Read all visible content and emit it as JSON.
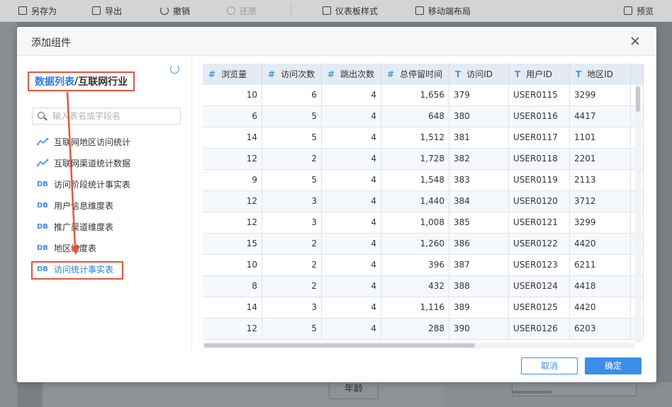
{
  "toolbar": {
    "save_as": "另存为",
    "export": "导出",
    "undo": "撤销",
    "redo": "还原",
    "dashboard_style": "仪表板样式",
    "mobile_layout": "移动端布局",
    "preview": "预览"
  },
  "background": {
    "tag_label": "年龄"
  },
  "dialog": {
    "title": "添加组件",
    "cancel_label": "取消",
    "ok_label": "确定"
  },
  "tree": {
    "breadcrumb_link": "数据列表",
    "breadcrumb_sep": "/",
    "breadcrumb_current": "互联网行业",
    "search_placeholder": "输入表名或字段名",
    "items": [
      {
        "icon": "chart-line-icon",
        "label": "互联网地区访问统计"
      },
      {
        "icon": "chart-line-icon",
        "label": "互联网渠道统计数据"
      },
      {
        "icon": "db-icon",
        "label": "访问阶段统计事实表"
      },
      {
        "icon": "db-icon",
        "label": "用户信息维度表"
      },
      {
        "icon": "db-icon",
        "label": "推广渠道维度表"
      },
      {
        "icon": "db-icon",
        "label": "地区维度表"
      },
      {
        "icon": "db-icon",
        "label": "访问统计事实表"
      }
    ],
    "db_glyph": "DB"
  },
  "grid": {
    "columns": [
      {
        "icon": "#",
        "label": "浏览量"
      },
      {
        "icon": "#",
        "label": "访问次数"
      },
      {
        "icon": "#",
        "label": "跳出次数"
      },
      {
        "icon": "#",
        "label": "总停留时间"
      },
      {
        "icon": "T",
        "label": "访问ID"
      },
      {
        "icon": "T",
        "label": "用户ID"
      },
      {
        "icon": "T",
        "label": "地区ID"
      }
    ],
    "rows": [
      [
        "10",
        "6",
        "4",
        "1,656",
        "379",
        "USER0115",
        "3299"
      ],
      [
        "6",
        "5",
        "4",
        "648",
        "380",
        "USER0116",
        "4417"
      ],
      [
        "14",
        "5",
        "4",
        "1,512",
        "381",
        "USER0117",
        "1101"
      ],
      [
        "12",
        "2",
        "4",
        "1,728",
        "382",
        "USER0118",
        "2201"
      ],
      [
        "9",
        "5",
        "4",
        "1,548",
        "383",
        "USER0119",
        "2113"
      ],
      [
        "12",
        "3",
        "4",
        "1,440",
        "384",
        "USER0120",
        "3712"
      ],
      [
        "12",
        "3",
        "4",
        "1,008",
        "385",
        "USER0121",
        "3299"
      ],
      [
        "15",
        "2",
        "4",
        "1,260",
        "386",
        "USER0122",
        "4420"
      ],
      [
        "10",
        "2",
        "4",
        "396",
        "387",
        "USER0123",
        "6211"
      ],
      [
        "8",
        "2",
        "4",
        "432",
        "388",
        "USER0124",
        "4418"
      ],
      [
        "14",
        "3",
        "4",
        "1,116",
        "389",
        "USER0125",
        "4420"
      ],
      [
        "12",
        "5",
        "4",
        "288",
        "390",
        "USER0126",
        "6203"
      ]
    ]
  },
  "colors": {
    "accent": "#3d8ee8",
    "annotation": "#e8543c",
    "header_bg": "#e5ebf3"
  }
}
